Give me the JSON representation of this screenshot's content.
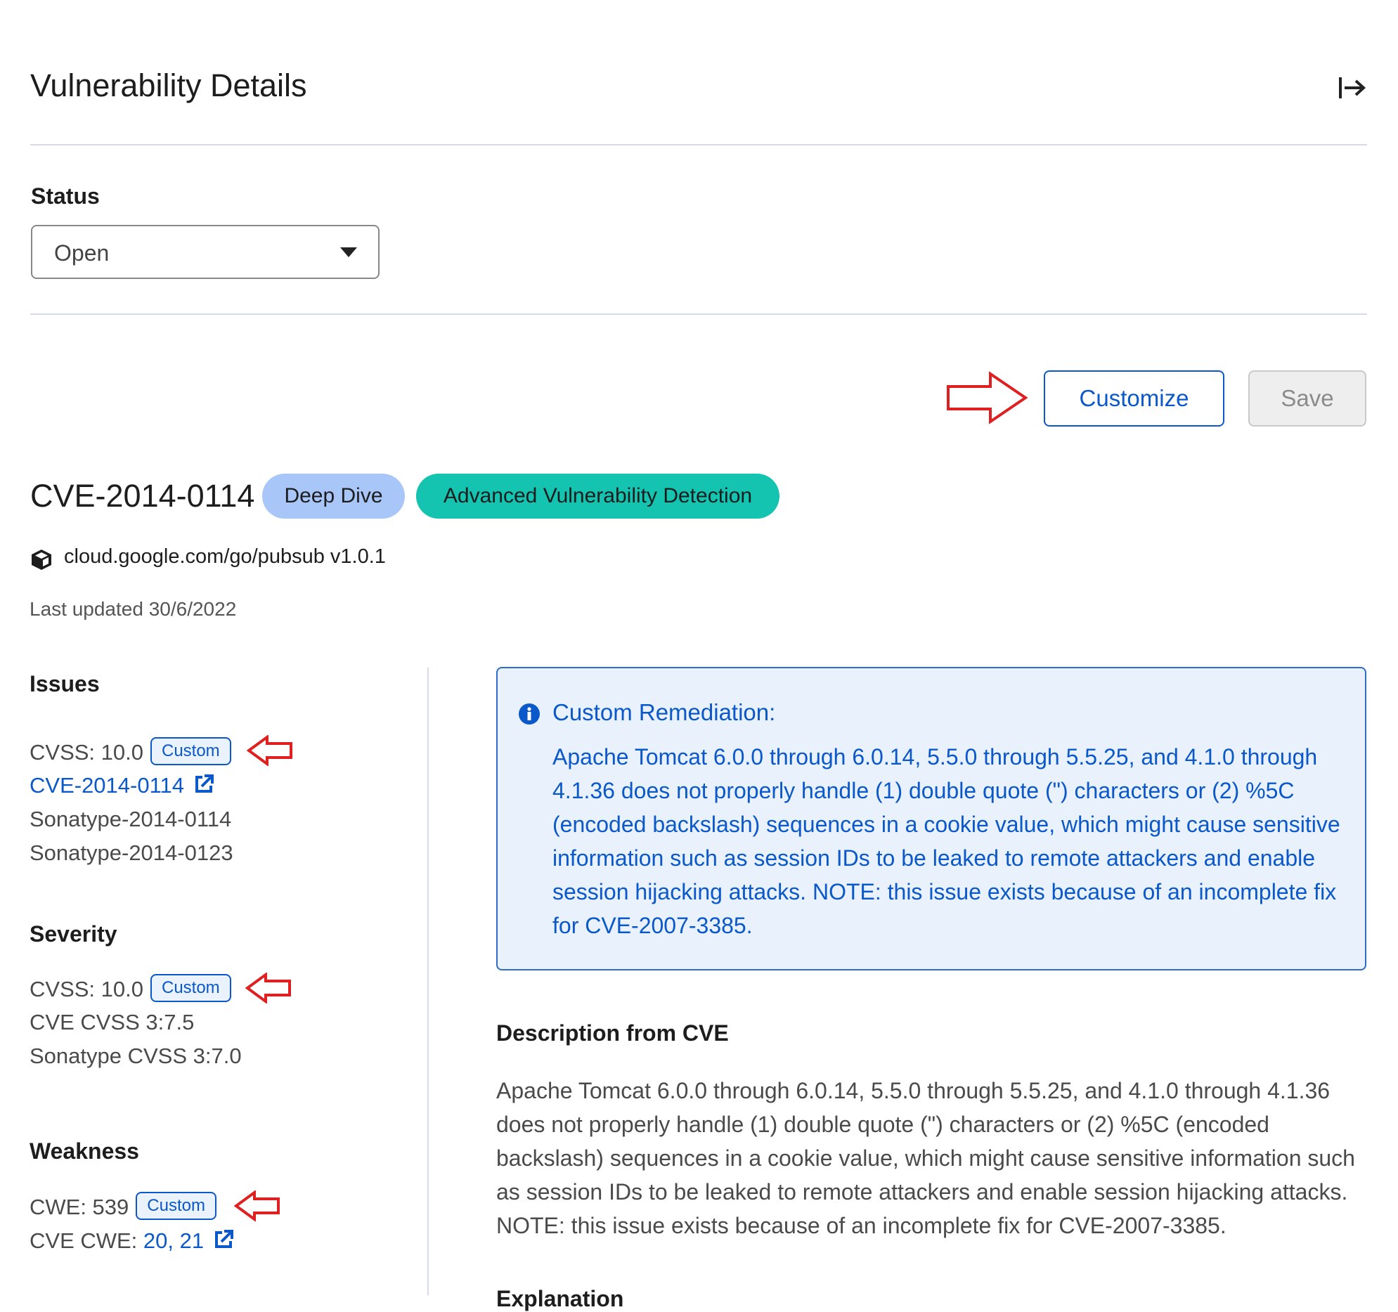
{
  "header": {
    "title": "Vulnerability Details",
    "close_icon": "collapse-right-icon"
  },
  "status": {
    "label": "Status",
    "selected": "Open"
  },
  "actions": {
    "customize_label": "Customize",
    "save_label": "Save"
  },
  "vulnerability": {
    "id": "CVE-2014-0114",
    "badges": [
      "Deep Dive",
      "Advanced Vulnerability Detection"
    ],
    "package": "cloud.google.com/go/pubsub v1.0.1",
    "last_updated": "Last updated 30/6/2022"
  },
  "issues": {
    "heading": "Issues",
    "cvss_prefix": "CVSS: 10.0",
    "custom_badge": "Custom",
    "cve_link": "CVE-2014-0114",
    "sonatype_ids": [
      "Sonatype-2014-0114",
      "Sonatype-2014-0123"
    ]
  },
  "severity": {
    "heading": "Severity",
    "cvss_prefix": "CVSS: 10.0",
    "custom_badge": "Custom",
    "lines": [
      "CVE CVSS 3:7.5",
      "Sonatype CVSS 3:7.0"
    ]
  },
  "weakness": {
    "heading": "Weakness",
    "cwe_prefix": "CWE: 539",
    "custom_badge": "Custom",
    "cve_cwe_prefix": "CVE CWE: ",
    "cve_cwe_links": "20, 21"
  },
  "remediation": {
    "title": "Custom Remediation:",
    "text": "Apache Tomcat 6.0.0 through 6.0.14, 5.5.0 through 5.5.25, and 4.1.0 through 4.1.36 does not properly handle (1) double quote (\") characters or (2) %5C (encoded backslash) sequences in a cookie value, which might cause sensitive information such as session IDs to be leaked to remote attackers and enable session hijacking attacks. NOTE: this issue exists because of an incomplete fix for CVE-2007-3385."
  },
  "description": {
    "heading": "Description from CVE",
    "text": "Apache Tomcat 6.0.0 through 6.0.14, 5.5.0 through 5.5.25, and 4.1.0 through 4.1.36 does not properly handle (1) double quote (\") characters or (2) %5C (encoded backslash) sequences in a cookie value, which might cause sensitive information such as session IDs to be leaked to remote attackers and enable session hijacking attacks. NOTE: this issue exists because of an incomplete fix for CVE-2007-3385."
  },
  "next_heading_partial": "Explanation",
  "colors": {
    "accent": "#0a58c9",
    "teal": "#14c3b0",
    "light_blue": "#a8c6f8",
    "annotation_red": "#e02020"
  }
}
